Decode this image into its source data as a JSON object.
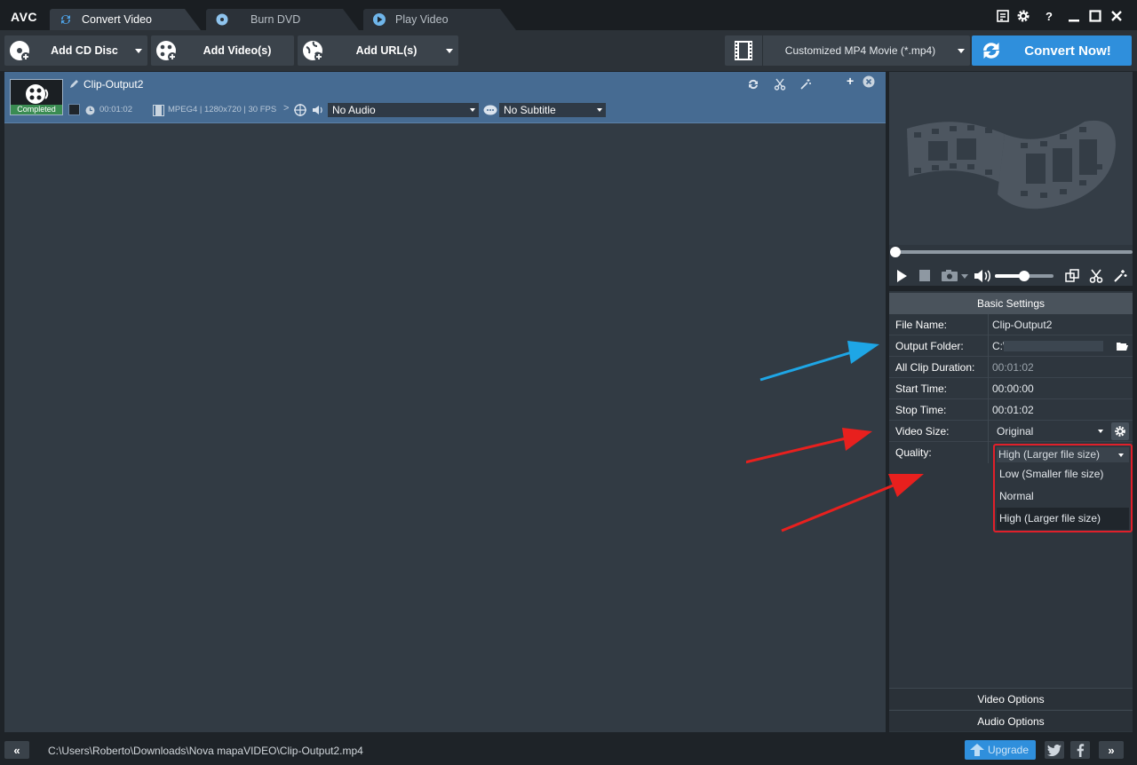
{
  "app": {
    "logo": "AVC"
  },
  "tabs": [
    {
      "label": "Convert Video",
      "active": true
    },
    {
      "label": "Burn DVD",
      "active": false
    },
    {
      "label": "Play Video",
      "active": false
    }
  ],
  "toolbar": {
    "add_cd_disc": "Add CD Disc",
    "add_videos": "Add Video(s)",
    "add_urls": "Add URL(s)",
    "format": "Customized MP4 Movie (*.mp4)",
    "convert_now": "Convert Now!"
  },
  "clip": {
    "name": "Clip-Output2",
    "status": "Completed",
    "duration": "00:01:02",
    "video_info": "MPEG4 | 1280x720 | 30 FPS",
    "audio": "No Audio",
    "subtitle": "No Subtitle"
  },
  "player": {
    "seek_progress": 0,
    "volume_level": 0.5
  },
  "settings": {
    "header": "Basic Settings",
    "rows": [
      {
        "label": "File Name:",
        "value": "Clip-Output2"
      },
      {
        "label": "Output Folder:",
        "value": "C:\\"
      },
      {
        "label": "All Clip Duration:",
        "value": "00:01:02"
      },
      {
        "label": "Start Time:",
        "value": "00:00:00"
      },
      {
        "label": "Stop Time:",
        "value": "00:01:02"
      },
      {
        "label": "Video Size:",
        "value": "Original"
      },
      {
        "label": "Quality:",
        "value": "High (Larger file size)"
      }
    ],
    "quality_options": [
      "Low (Smaller file size)",
      "Normal",
      "High (Larger file size)"
    ],
    "video_options": "Video Options",
    "audio_options": "Audio Options"
  },
  "statusbar": {
    "path": "C:\\Users\\Roberto\\Downloads\\Nova mapaVIDEO\\Clip-Output2.mp4",
    "upgrade": "Upgrade"
  },
  "colors": {
    "accent": "#2f8fdc",
    "selected_row": "#466b92",
    "completed": "#3a8c52",
    "highlight": "#e0202a"
  }
}
